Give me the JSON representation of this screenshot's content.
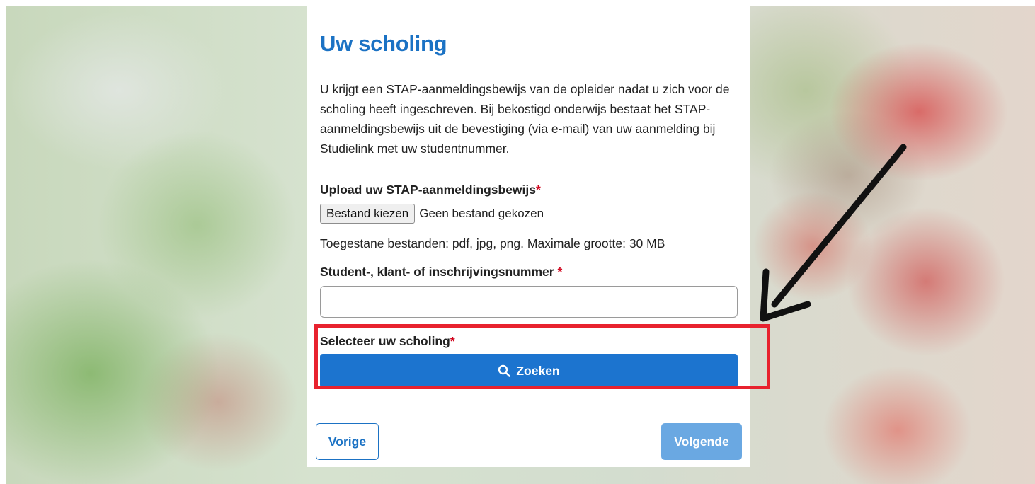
{
  "form": {
    "title": "Uw scholing",
    "intro": "U krijgt een STAP-aanmeldingsbewijs van de opleider nadat u zich voor de scholing heeft ingeschreven. Bij bekostigd onderwijs bestaat het STAP-aanmeldingsbewijs uit de bevestiging (via e-mail) van uw aanmelding bij Studielink met uw studentnummer.",
    "upload": {
      "label": "Upload uw STAP-aanmeldingsbewijs",
      "required_mark": "*",
      "button_label": "Bestand kiezen",
      "status": "Geen bestand gekozen",
      "hint": "Toegestane bestanden: pdf, jpg, png. Maximale grootte: 30 MB"
    },
    "student_number": {
      "label": "Student-, klant- of inschrijvingsnummer ",
      "required_mark": "*",
      "value": ""
    },
    "course_select": {
      "label": "Selecteer uw scholing",
      "required_mark": "*",
      "button_label": "Zoeken"
    },
    "nav": {
      "previous_label": "Vorige",
      "next_label": "Volgende"
    }
  },
  "colors": {
    "heading": "#1b72c4",
    "primary": "#1c74cf",
    "primary_disabled": "#6aa8e2",
    "required": "#d0021b",
    "highlight": "#e8222e",
    "arrow": "#111111"
  }
}
